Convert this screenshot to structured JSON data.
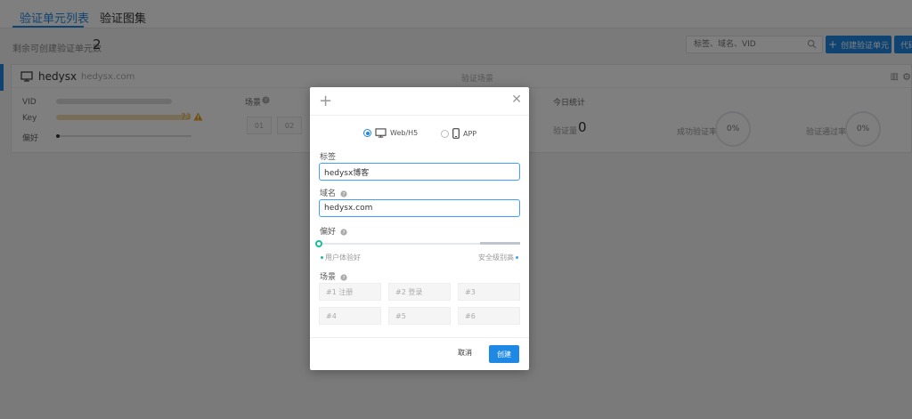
{
  "tabs": [
    {
      "label": "验证单元列表",
      "active": true
    },
    {
      "label": "验证图集",
      "active": false
    }
  ],
  "toolbar": {
    "remaining_label": "剩余可创建验证单元数",
    "remaining_count": "2",
    "search_placeholder": "标签、域名、VID",
    "create_button": "创建验证单元",
    "extra_button": "代码"
  },
  "card": {
    "name": "hedysx",
    "domain": "hedysx.com",
    "middle_header": "验证场景",
    "vid_label": "VID",
    "key_label": "Key",
    "key_suffix": "73",
    "pref_label": "偏好",
    "scene_title": "场景",
    "scene_chips": [
      "01",
      "02"
    ],
    "today_title": "今日统计",
    "verify_label": "验证量",
    "verify_count": "0",
    "pass_rate_label": "成功验证率",
    "pass_rate": "0%",
    "block_rate_label": "验证通过率",
    "block_rate": "0%"
  },
  "modal": {
    "platforms": [
      {
        "label": "Web/H5",
        "checked": true
      },
      {
        "label": "APP",
        "checked": false
      }
    ],
    "tag_label": "标签",
    "tag_value": "hedysx博客",
    "domain_label": "域名",
    "domain_value": "hedysx.com",
    "pref_label": "偏好",
    "pref_left": "用户体验好",
    "pref_right": "安全级别高",
    "pref_value": 0,
    "scene_label": "场景",
    "scenes": [
      "#1 注册",
      "#2 登录",
      "#3",
      "#4",
      "#5",
      "#6"
    ],
    "cancel_button": "取消",
    "confirm_button": "创建"
  },
  "colors": {
    "primary": "#1e88e5",
    "slider_knob": "#1abc9c",
    "warning": "#e0a020"
  },
  "icons": [
    "search-icon",
    "monitor-icon",
    "mobile-icon",
    "warning-icon",
    "help-icon",
    "chart-icon",
    "gear-icon",
    "close-icon",
    "plus-icon"
  ]
}
